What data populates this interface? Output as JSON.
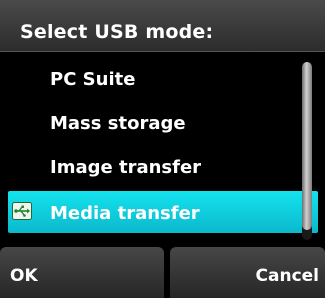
{
  "dialog": {
    "title": "Select USB mode:"
  },
  "options": [
    {
      "label": "PC Suite",
      "selected": false
    },
    {
      "label": "Mass storage",
      "selected": false
    },
    {
      "label": "Image transfer",
      "selected": false
    },
    {
      "label": "Media transfer",
      "selected": true,
      "icon": "usb-icon"
    }
  ],
  "softkeys": {
    "left_label": "OK",
    "right_label": "Cancel"
  },
  "colors": {
    "selection": "#14e3ee",
    "background": "#000000",
    "header": "#3a3a3a"
  }
}
